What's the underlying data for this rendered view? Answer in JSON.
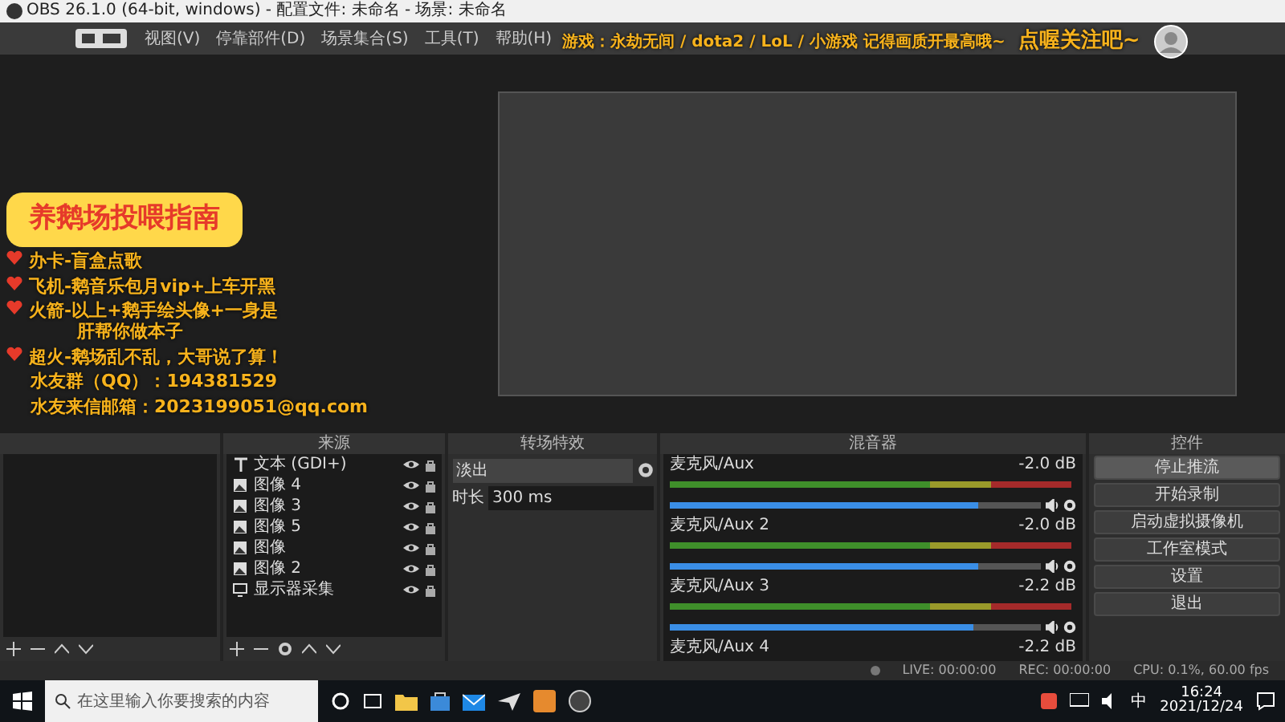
{
  "window": {
    "title": "OBS 26.1.0 (64-bit, windows) - 配置文件: 未命名 - 场景: 未命名"
  },
  "menu": [
    "视图(V)",
    "停靠部件(D)",
    "场景集合(S)",
    "工具(T)",
    "帮助(H)"
  ],
  "banner": {
    "games": "游戏：永劫无间 / dota2 / LoL / 小游戏   记得画质开最高哦~",
    "follow": "点喔关注吧~"
  },
  "guide": {
    "title": "养鹅场投喂指南",
    "items": [
      {
        "text": "办卡-盲盒点歌"
      },
      {
        "text": "飞机-鹅音乐包月vip+上车开黑"
      },
      {
        "text": "火箭-以上+鹅手绘头像+一身是",
        "note": "肝帮你做本子"
      },
      {
        "text": "超火-鹅场乱不乱，大哥说了算！"
      }
    ],
    "contacts": [
      "水友群（QQ）：194381529",
      "水友来信邮箱：2023199051@qq.com"
    ]
  },
  "sources": {
    "title": "来源",
    "items": [
      {
        "name": "文本 (GDI+)",
        "kind": "text"
      },
      {
        "name": "图像 4",
        "kind": "image"
      },
      {
        "name": "图像 3",
        "kind": "image"
      },
      {
        "name": "图像 5",
        "kind": "image"
      },
      {
        "name": "图像",
        "kind": "image"
      },
      {
        "name": "图像 2",
        "kind": "image"
      },
      {
        "name": "显示器采集",
        "kind": "display"
      }
    ]
  },
  "transitions": {
    "title": "转场特效",
    "effect": "淡出",
    "duration_label": "时长",
    "duration": "300 ms"
  },
  "mixer": {
    "title": "混音器",
    "channels": [
      {
        "name": "麦克风/Aux",
        "reading": "-2.0 dB",
        "level": 0.83
      },
      {
        "name": "麦克风/Aux 2",
        "reading": "-2.0 dB",
        "level": 0.83
      },
      {
        "name": "麦克风/Aux 3",
        "reading": "-2.2 dB",
        "level": 0.82
      },
      {
        "name": "麦克风/Aux 4",
        "reading": "-2.2 dB"
      }
    ]
  },
  "controls": {
    "title": "控件",
    "buttons": [
      {
        "label": "停止推流",
        "active": true
      },
      {
        "label": "开始录制",
        "active": false
      },
      {
        "label": "启动虚拟摄像机",
        "active": false
      },
      {
        "label": "工作室模式",
        "active": false
      },
      {
        "label": "设置",
        "active": false
      },
      {
        "label": "退出",
        "active": false
      }
    ]
  },
  "status_bar": {
    "live": "LIVE: 00:00:00",
    "rec": "REC: 00:00:00",
    "cpu": "CPU: 0.1%, 60.00 fps"
  },
  "taskbar": {
    "search": {
      "placeholder": "在这里输入你要搜索的内容"
    },
    "ime": "中",
    "time": "16:24",
    "date": "2021/12/24"
  }
}
